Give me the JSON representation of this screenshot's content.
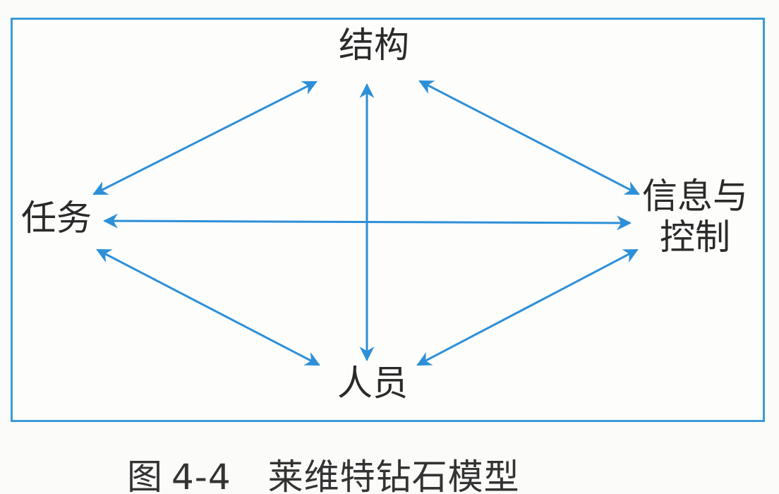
{
  "diagram": {
    "nodes": {
      "structure": "结构",
      "task": "任务",
      "info_line1": "信息与",
      "info_line2": "控制",
      "people": "人员"
    },
    "edges": [
      {
        "from": "structure",
        "to": "task"
      },
      {
        "from": "structure",
        "to": "people"
      },
      {
        "from": "structure",
        "to": "info"
      },
      {
        "from": "task",
        "to": "info"
      },
      {
        "from": "task",
        "to": "people"
      },
      {
        "from": "people",
        "to": "info"
      }
    ],
    "arrow_color": "#2d8fd8",
    "frame_color": "#3a9ad9"
  },
  "caption": {
    "label": "图",
    "number": "4-4",
    "title": "莱维特钻石模型"
  }
}
